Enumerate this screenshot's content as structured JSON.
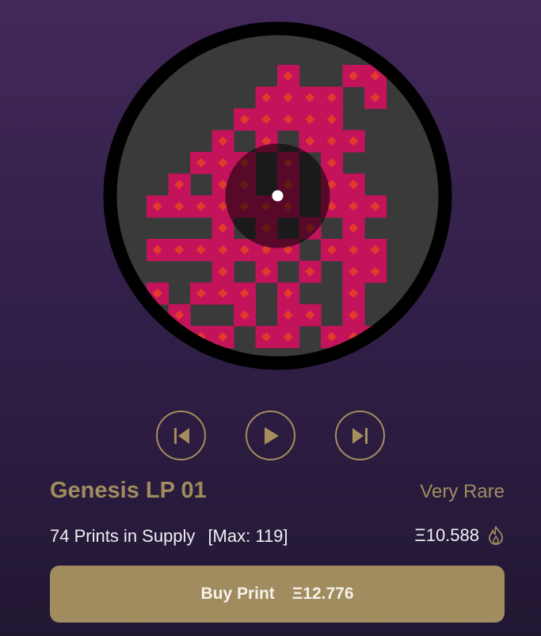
{
  "record": {
    "title": "Genesis LP 01",
    "rarity": "Very Rare",
    "supply_text": "74 Prints in Supply",
    "max_text": "[Max: 119]",
    "burn_price": "Ξ10.588"
  },
  "controls": {
    "prev_icon": "skip-back-icon",
    "play_icon": "play-icon",
    "next_icon": "skip-forward-icon"
  },
  "buy": {
    "label": "Buy Print",
    "price": "Ξ12.776"
  },
  "colors": {
    "accent": "#a08c5e",
    "tile": "#c3145b",
    "diamond": "#e33a2c",
    "disc": "#3a3a3a"
  }
}
